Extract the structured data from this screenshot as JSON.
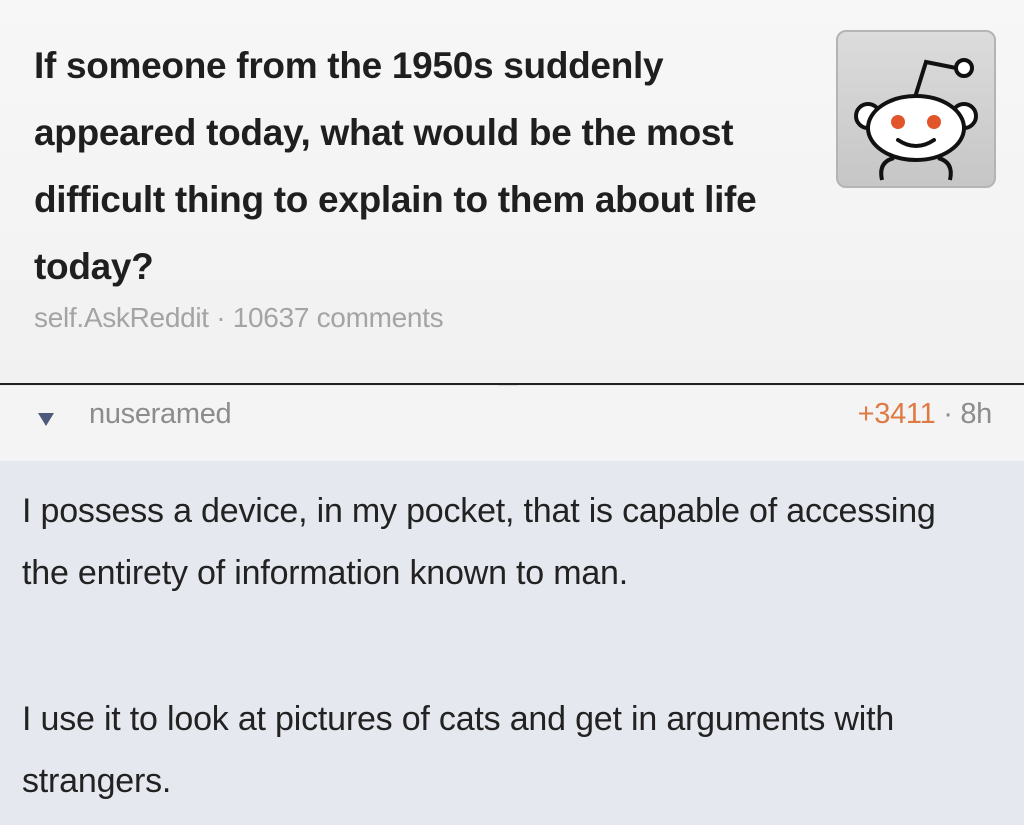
{
  "post": {
    "title": "If someone from the 1950s suddenly appeared today, what would be the most difficult thing to explain to them about life today?",
    "domain": "self.AskReddit",
    "separator": "·",
    "comments": "10637 comments",
    "thumbnail_icon": "reddit-alien-icon"
  },
  "comment": {
    "collapse_icon": "collapse-triangle-icon",
    "author": "nuseramed",
    "score": "+3411",
    "separator": "·",
    "age": "8h",
    "paragraphs": [
      "I possess a device, in my pocket, that is capable of accessing the entirety of information known to man.",
      "I use it to look at pictures of cats and get in arguments with strangers."
    ]
  },
  "colors": {
    "score": "#e07a44",
    "meta": "#a4a4a4",
    "comment_bg": "#e6e8ef",
    "collapse_icon": "#4d5a7c"
  }
}
